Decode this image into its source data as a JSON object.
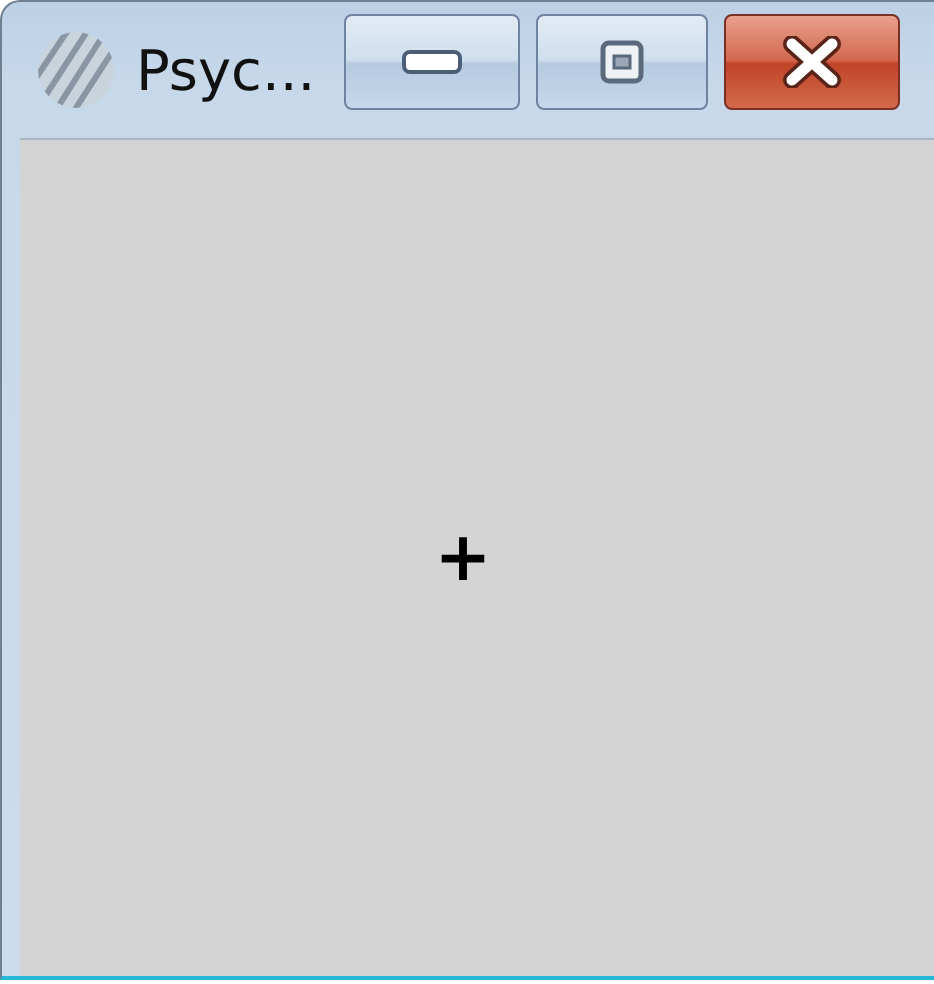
{
  "window": {
    "title": "Psyc..."
  },
  "title_buttons": [
    {
      "kind": "minimize"
    },
    {
      "kind": "maximize"
    },
    {
      "kind": "close"
    }
  ],
  "stimulus": {
    "text": "+"
  }
}
